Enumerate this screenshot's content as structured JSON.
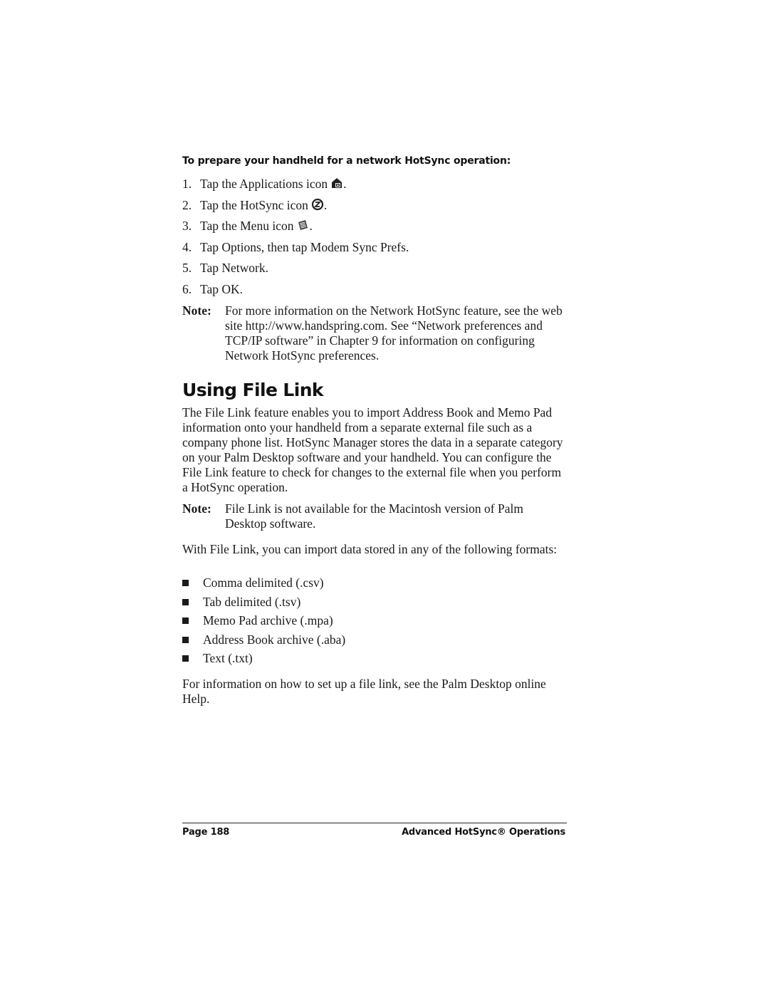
{
  "procedure": {
    "heading": "To prepare your handheld for a network HotSync operation:",
    "steps": [
      {
        "num": "1.",
        "text": "Tap the Applications icon",
        "icon": "applications-icon",
        "after": "."
      },
      {
        "num": "2.",
        "text": "Tap the HotSync icon",
        "icon": "hotsync-icon",
        "after": "."
      },
      {
        "num": "3.",
        "text": "Tap the Menu icon",
        "icon": "menu-icon",
        "after": "."
      },
      {
        "num": "4.",
        "text": "Tap Options, then tap Modem Sync Prefs."
      },
      {
        "num": "5.",
        "text": "Tap Network."
      },
      {
        "num": "6.",
        "text": "Tap OK."
      }
    ],
    "note": {
      "label": "Note:",
      "text": "For more information on the Network HotSync feature, see the web site http://www.handspring.com. See “Network preferences and TCP/IP software” in Chapter 9 for information on configuring Network HotSync preferences."
    }
  },
  "section": {
    "title": "Using File Link",
    "intro": "The File Link feature enables you to import Address Book and Memo Pad information onto your handheld from a separate external file such as a company phone list. HotSync Manager stores the data in a separate category on your Palm Desktop software and your handheld. You can configure the File Link feature to check for changes to the external file when you perform a HotSync operation.",
    "note": {
      "label": "Note:",
      "text": "File Link is not available for the Macintosh version of Palm Desktop software."
    },
    "formats_intro": "With File Link, you can import data stored in any of the following formats:",
    "formats": [
      "Comma delimited (.csv)",
      "Tab delimited (.tsv)",
      "Memo Pad archive (.mpa)",
      "Address Book archive (.aba)",
      "Text (.txt)"
    ],
    "closing": "For information on how to set up a file link, see the Palm Desktop online Help."
  },
  "footer": {
    "page_label": "Page 188",
    "chapter_title": "Advanced HotSync® Operations"
  }
}
